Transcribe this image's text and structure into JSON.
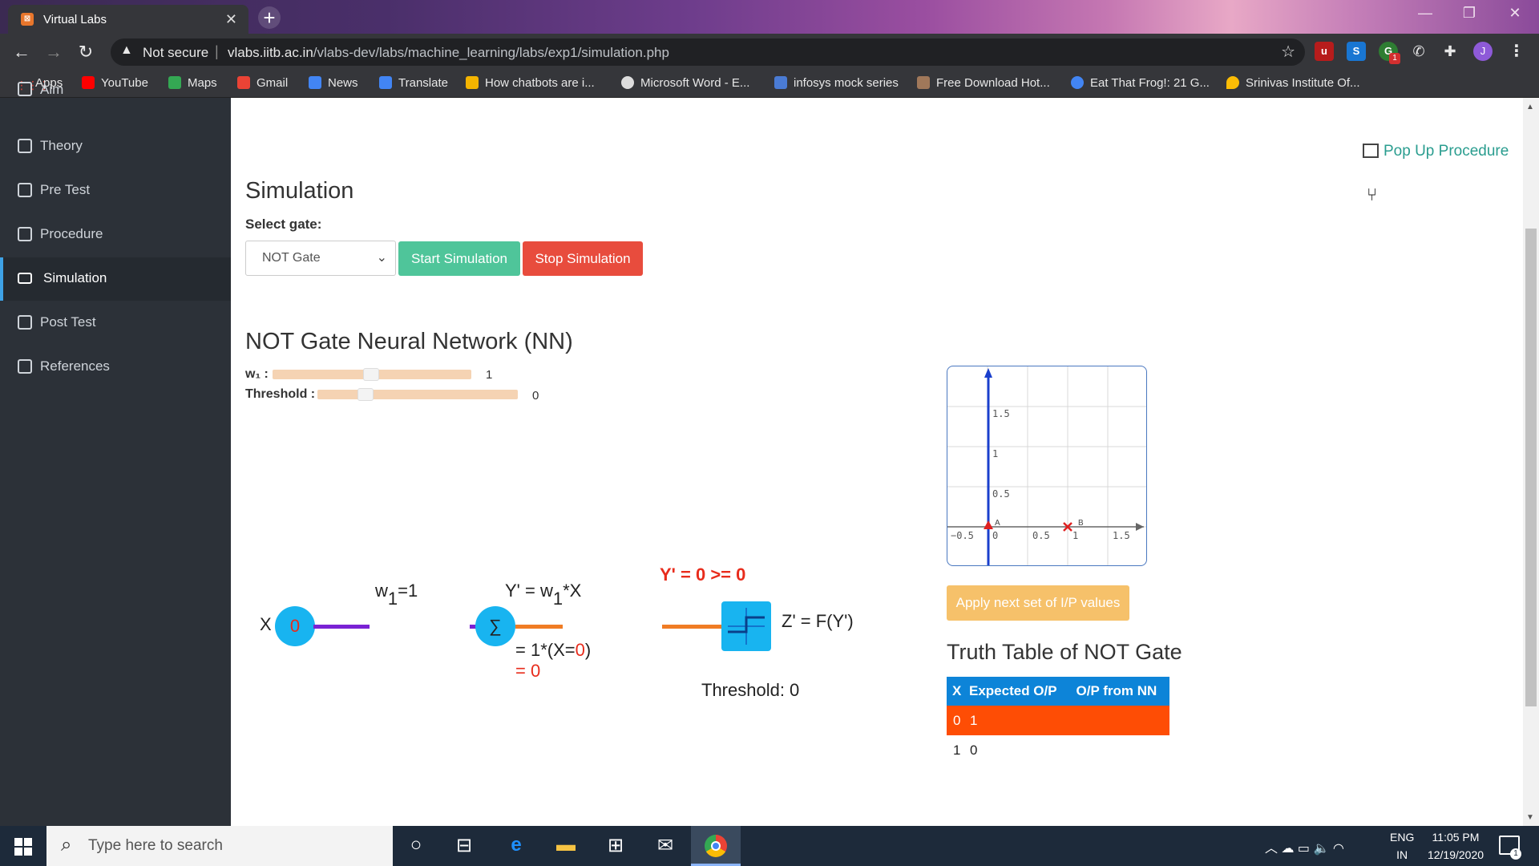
{
  "browser": {
    "tab_title": "Virtual Labs",
    "tab_close": "✕",
    "new_tab": "+",
    "not_secure": "Not secure",
    "url_host": "vlabs.iitb.ac.in",
    "url_path": "/vlabs-dev/labs/machine_learning/labs/exp1/simulation.php",
    "profile_initial": "J",
    "ext_badge": "1"
  },
  "bookmarks": [
    {
      "label": "Apps",
      "color": "#e0463a"
    },
    {
      "label": "YouTube",
      "color": "#ff0000"
    },
    {
      "label": "Maps",
      "color": "#34a853"
    },
    {
      "label": "Gmail",
      "color": "#ea4335"
    },
    {
      "label": "News",
      "color": "#4285f4"
    },
    {
      "label": "Translate",
      "color": "#4285f4"
    },
    {
      "label": "How chatbots are i...",
      "color": "#f4b400"
    },
    {
      "label": "Microsoft Word - E...",
      "color": "#dddddd"
    },
    {
      "label": "infosys mock series",
      "color": "#4a7bd4"
    },
    {
      "label": "Free Download Hot...",
      "color": "#a0785a"
    },
    {
      "label": "Eat That Frog!: 21 G...",
      "color": "#4285f4"
    },
    {
      "label": "Srinivas Institute Of...",
      "color": "#fbbc05"
    }
  ],
  "sidebar": {
    "items": [
      {
        "label": "Aim"
      },
      {
        "label": "Theory"
      },
      {
        "label": "Pre Test"
      },
      {
        "label": "Procedure"
      },
      {
        "label": "Simulation"
      },
      {
        "label": "Post Test"
      },
      {
        "label": "References"
      }
    ]
  },
  "main": {
    "popup_label": "Pop Up Procedure",
    "title": "Simulation",
    "select_label": "Select gate:",
    "selected_gate": "NOT Gate",
    "start_label": "Start Simulation",
    "stop_label": "Stop Simulation",
    "nn_title": "NOT Gate Neural Network (NN)",
    "w1_label": "w₁ :",
    "w1_value": "1",
    "threshold_label": "Threshold :",
    "threshold_value": "0"
  },
  "diagram": {
    "x_label": "X",
    "x_value": "0",
    "w_label": "w",
    "w_sub": "1",
    "w_eq": "=1",
    "y_eq_prefix": "Y' = w",
    "y_eq_sub": "1",
    "y_eq_suffix": "*X",
    "sigma": "∑",
    "calc_prefix": "= 1*(X=",
    "calc_x": "0",
    "calc_suffix": ")",
    "calc_result": "= 0",
    "compare": "Y' = 0 >= 0",
    "z_eq": "Z' = F(Y')",
    "threshold_text": "Threshold: 0"
  },
  "graph": {
    "ticks_y": [
      "1.5",
      "1",
      "0.5"
    ],
    "ticks_x": [
      "−0.5",
      "0",
      "0.5",
      "1",
      "1.5"
    ],
    "point_a": "A",
    "point_b": "B"
  },
  "truth_table": {
    "apply_label": "Apply next set of I/P values",
    "title": "Truth Table of NOT Gate",
    "headers": [
      "X",
      "Expected O/P",
      "O/P from NN"
    ],
    "rows": [
      [
        "0",
        "1",
        ""
      ],
      [
        "1",
        "0",
        ""
      ]
    ]
  },
  "taskbar": {
    "search_placeholder": "Type here to search",
    "lang_top": "ENG",
    "lang_bottom": "IN",
    "time": "11:05 PM",
    "date": "12/19/2020",
    "notif_count": "1"
  }
}
